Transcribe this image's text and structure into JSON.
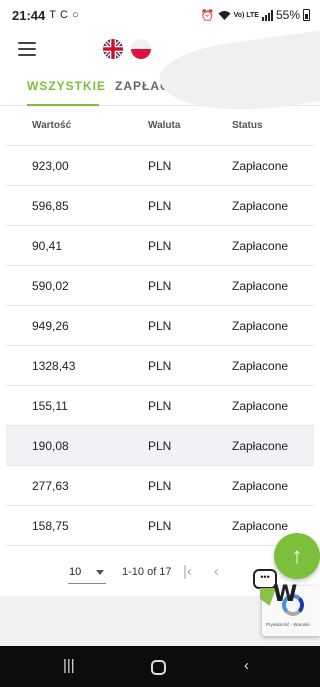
{
  "status_bar": {
    "time": "21:44",
    "left_icons": [
      "tesla-icon",
      "c-icon",
      "circle-icon"
    ],
    "right_icons": [
      "alarm-icon",
      "wifi-icon",
      "volte-icon",
      "signal-icon"
    ],
    "volte_label": "Vo) LTE",
    "battery": "55%"
  },
  "header": {
    "menu_icon": "hamburger-icon",
    "languages": [
      {
        "code": "en",
        "icon": "uk-flag-icon"
      },
      {
        "code": "pl",
        "icon": "pl-flag-icon"
      }
    ]
  },
  "tabs": [
    {
      "label": "WSZYSTKIE",
      "active": true
    },
    {
      "label": "ZAPŁACONE",
      "active": false
    }
  ],
  "accent_color": "#7cbf3a",
  "table": {
    "columns": [
      "Wartość",
      "Waluta",
      "Status"
    ],
    "rows": [
      {
        "value": "923,00",
        "currency": "PLN",
        "status": "Zapłacone",
        "highlighted": false
      },
      {
        "value": "596,85",
        "currency": "PLN",
        "status": "Zapłacone",
        "highlighted": false
      },
      {
        "value": "90,41",
        "currency": "PLN",
        "status": "Zapłacone",
        "highlighted": false
      },
      {
        "value": "590,02",
        "currency": "PLN",
        "status": "Zapłacone",
        "highlighted": false
      },
      {
        "value": "949,26",
        "currency": "PLN",
        "status": "Zapłacone",
        "highlighted": false
      },
      {
        "value": "1328,43",
        "currency": "PLN",
        "status": "Zapłacone",
        "highlighted": false
      },
      {
        "value": "155,11",
        "currency": "PLN",
        "status": "Zapłacone",
        "highlighted": false
      },
      {
        "value": "190,08",
        "currency": "PLN",
        "status": "Zapłacone",
        "highlighted": true
      },
      {
        "value": "277,63",
        "currency": "PLN",
        "status": "Zapłacone",
        "highlighted": false
      },
      {
        "value": "158,75",
        "currency": "PLN",
        "status": "Zapłacone",
        "highlighted": false
      }
    ]
  },
  "pagination": {
    "per_page": "10",
    "range": "1-10 of 17",
    "first_icon": "first-page-icon",
    "prev_icon": "prev-page-icon"
  },
  "fab": {
    "icon": "arrow-up-icon",
    "glyph": "↑"
  },
  "chat": {
    "icon": "chat-icon",
    "glyph": "•••"
  },
  "brand_logo": {
    "text": "W"
  },
  "recaptcha": {
    "text": "Prywatność - Warunki"
  },
  "nav_bar": {
    "recents_glyph": "|||",
    "back_glyph": "‹"
  }
}
